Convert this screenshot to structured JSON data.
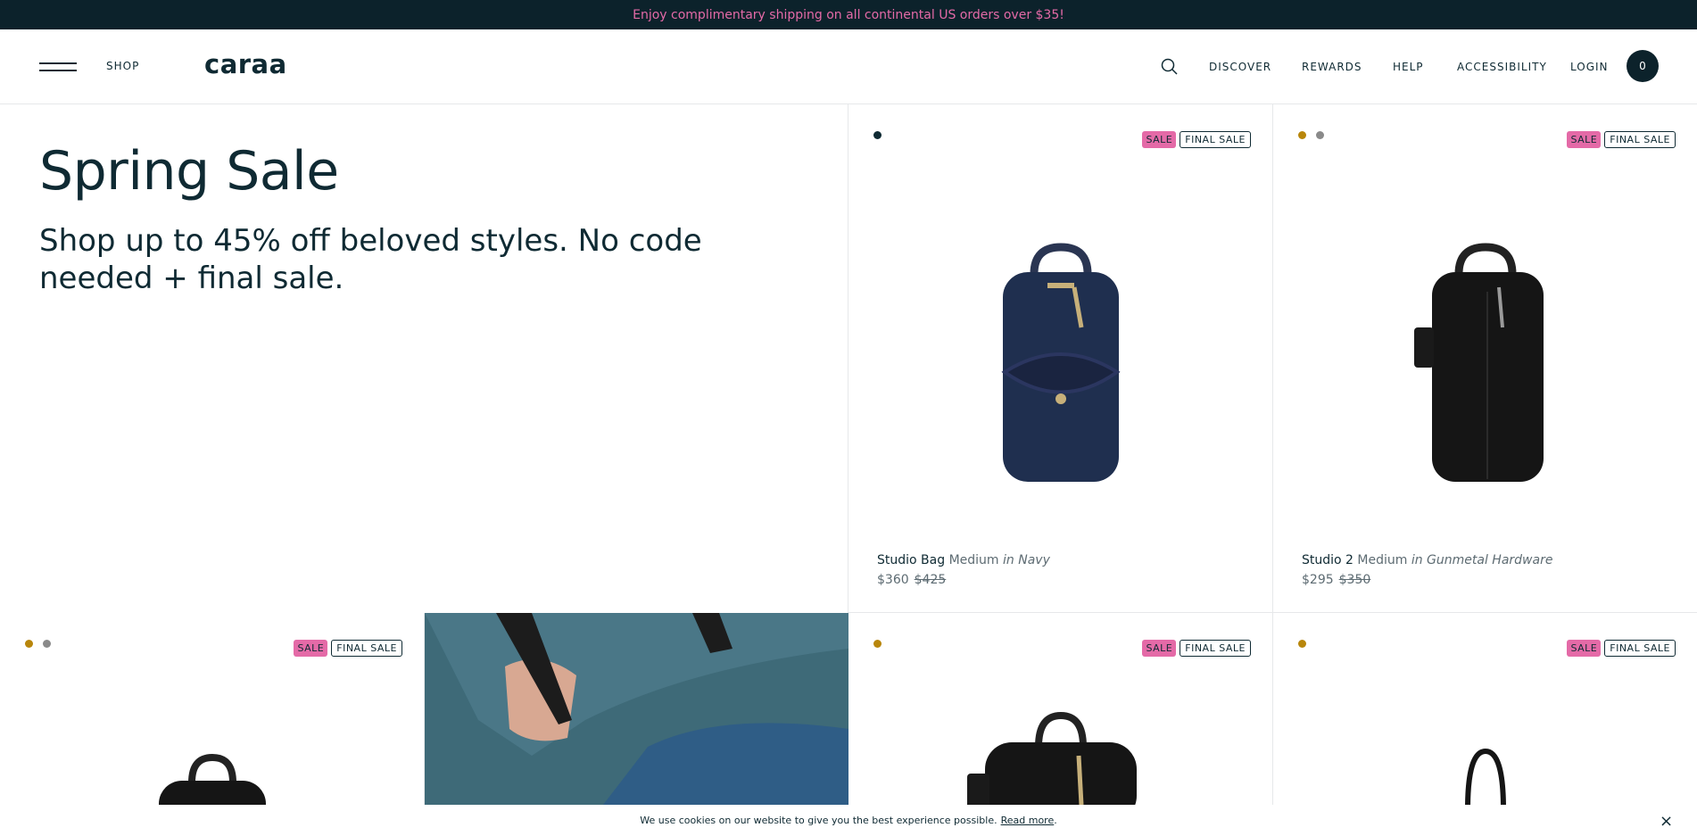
{
  "promo": {
    "text": "Enjoy complimentary shipping on all continental US orders over $35!"
  },
  "header": {
    "shop_label": "SHOP",
    "logo": "caraa",
    "nav": [
      "DISCOVER",
      "REWARDS",
      "HELP",
      "ACCESSIBILITY",
      "LOGIN"
    ],
    "cart_count": "0",
    "icons": {
      "menu": "hamburger-icon",
      "search": "search-icon"
    }
  },
  "hero": {
    "title": "Spring Sale",
    "subtitle": "Shop up to 45% off beloved styles. No code needed + final sale."
  },
  "badges": {
    "sale": "SALE",
    "final_sale": "FINAL SALE"
  },
  "products": [
    {
      "name": "Studio Bag",
      "size": "Medium",
      "variant": "in Navy",
      "price": "$360",
      "original_price": "$425",
      "swatches": [
        "#0f2a33"
      ],
      "bag_color": "#1f2f4f"
    },
    {
      "name": "Studio 2",
      "size": "Medium",
      "variant": "in Gunmetal Hardware",
      "price": "$295",
      "original_price": "$350",
      "swatches": [
        "#b8860b",
        "#8a8a8a"
      ],
      "bag_color": "#151515"
    },
    {
      "swatches": [
        "#b8860b",
        "#8a8a8a"
      ],
      "bag_color": "#151515"
    },
    {
      "swatches": [
        "#b8860b"
      ],
      "bag_color": "#151515"
    },
    {
      "swatches": [
        "#b8860b"
      ],
      "bag_color": "#151515"
    }
  ],
  "cookie": {
    "text": "We use cookies on our website to give you the best experience possible.",
    "link": "Read more",
    "close": "×"
  },
  "colors": {
    "dark": "#0c222b",
    "pink": "#e46aa7",
    "text": "#0f2a33",
    "muted": "#5d6b72"
  }
}
